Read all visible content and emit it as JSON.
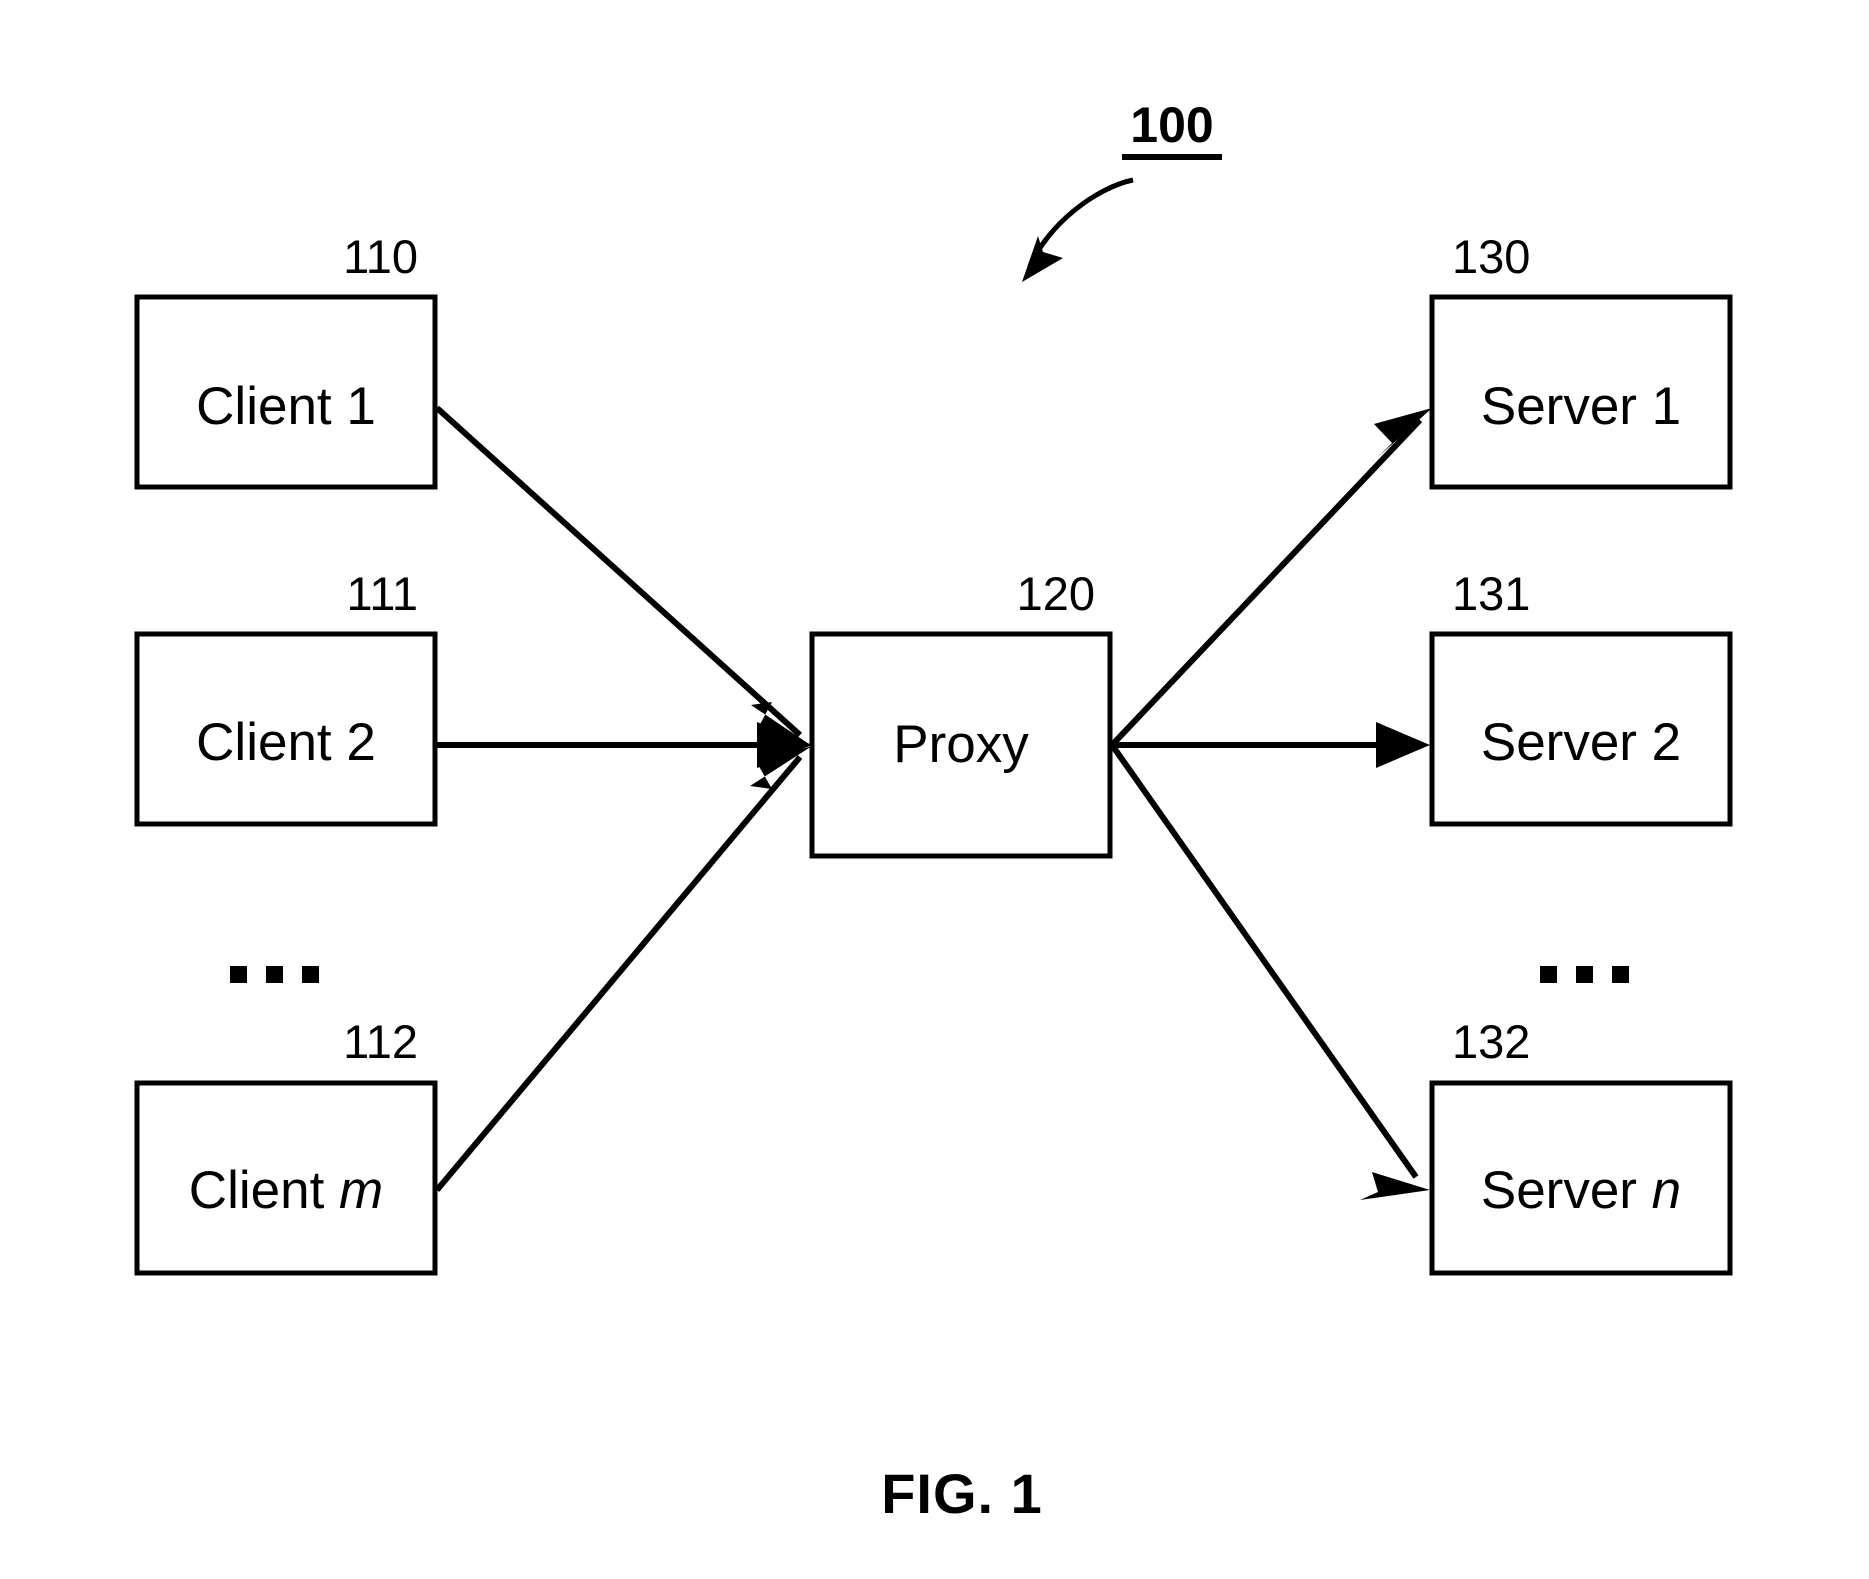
{
  "figure": {
    "caption": "FIG. 1",
    "system_ref": "100",
    "background_color": "#ffffff",
    "line_color": "#000000"
  },
  "nodes": {
    "clients": [
      {
        "ref": "110",
        "label_prefix": "Client ",
        "label_var": "1",
        "var_italic": false,
        "full_label": "Client 1"
      },
      {
        "ref": "111",
        "label_prefix": "Client ",
        "label_var": "2",
        "var_italic": false,
        "full_label": "Client 2"
      },
      {
        "ref": "112",
        "label_prefix": "Client ",
        "label_var": "m",
        "var_italic": true,
        "full_label": "Client m"
      }
    ],
    "proxy": {
      "ref": "120",
      "label_prefix": "Proxy",
      "label_var": "",
      "var_italic": false,
      "full_label": "Proxy"
    },
    "servers": [
      {
        "ref": "130",
        "label_prefix": "Server ",
        "label_var": "1",
        "var_italic": false,
        "full_label": "Server 1"
      },
      {
        "ref": "131",
        "label_prefix": "Server ",
        "label_var": "2",
        "var_italic": false,
        "full_label": "Server 2"
      },
      {
        "ref": "132",
        "label_prefix": "Server ",
        "label_var": "n",
        "var_italic": true,
        "full_label": "Server n"
      }
    ]
  },
  "ellipsis": {
    "clients_continuation": "...",
    "servers_continuation": "..."
  },
  "connections": [
    {
      "from": "Client 1",
      "to": "Proxy",
      "direction": "to-proxy"
    },
    {
      "from": "Client 2",
      "to": "Proxy",
      "direction": "to-proxy"
    },
    {
      "from": "Client m",
      "to": "Proxy",
      "direction": "to-proxy"
    },
    {
      "from": "Proxy",
      "to": "Server 1",
      "direction": "from-proxy"
    },
    {
      "from": "Proxy",
      "to": "Server 2",
      "direction": "from-proxy"
    },
    {
      "from": "Proxy",
      "to": "Server n",
      "direction": "from-proxy"
    }
  ]
}
